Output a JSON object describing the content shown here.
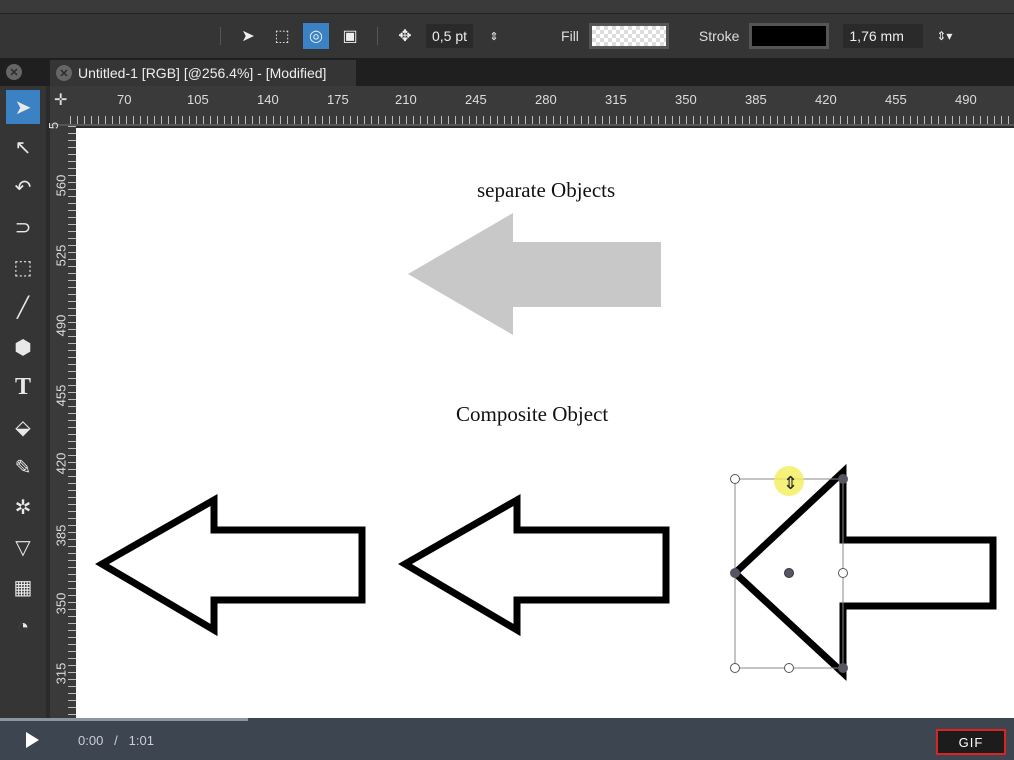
{
  "toolbar": {
    "nudge_value": "0,5 pt",
    "fill_label": "Fill",
    "stroke_label": "Stroke",
    "stroke_width": "1,76 mm"
  },
  "document_tab": {
    "title": "Untitled-1 [RGB] [@256.4%] - [Modified]"
  },
  "rulers": {
    "horizontal": [
      "70",
      "105",
      "140",
      "175",
      "210",
      "245",
      "280",
      "315",
      "350",
      "385",
      "420",
      "455",
      "490"
    ],
    "vertical": [
      "5",
      "560",
      "525",
      "490",
      "455",
      "420",
      "385",
      "350",
      "315"
    ]
  },
  "canvas": {
    "label_separate": "separate Objects",
    "label_composite": "Composite Object",
    "gray_arrow_color": "#c8c8c8",
    "outline_color": "#000000"
  },
  "player": {
    "current_time": "0:00",
    "separator": "/",
    "duration": "1:01",
    "gif_label": "GIF",
    "progress_fraction": 0.24
  }
}
